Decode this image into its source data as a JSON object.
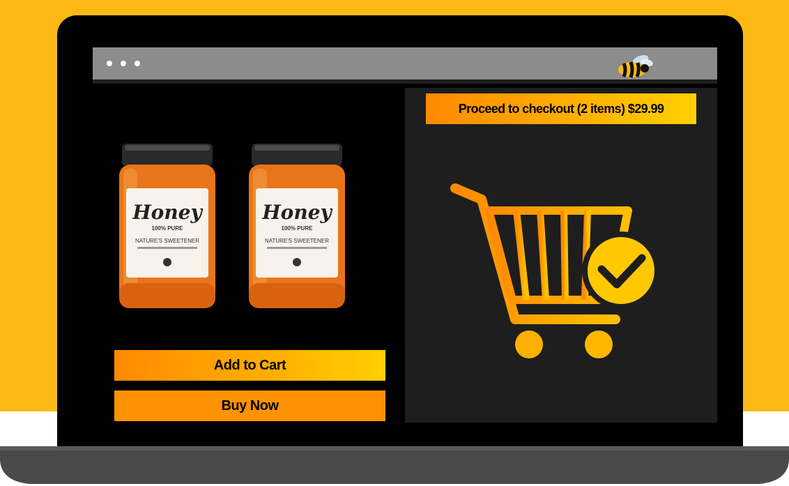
{
  "browser": {
    "menu_icon": "three-dots-icon",
    "logo_icon": "bee-icon"
  },
  "products": [
    {
      "label_title": "Honey",
      "label_line1": "100% PURE",
      "label_line2": "NATURE'S SWEETENER"
    },
    {
      "label_title": "Honey",
      "label_line1": "100% PURE",
      "label_line2": "NATURE'S SWEETENER"
    }
  ],
  "actions": {
    "add_to_cart": "Add to Cart",
    "buy_now": "Buy Now"
  },
  "checkout": {
    "label": "Proceed to checkout (2 items) $29.99"
  },
  "cart": {
    "icon": "cart-check-icon"
  },
  "colors": {
    "brand_yellow": "#FDB913",
    "accent_orange": "#FF9200",
    "accent_gold": "#FFD000"
  }
}
